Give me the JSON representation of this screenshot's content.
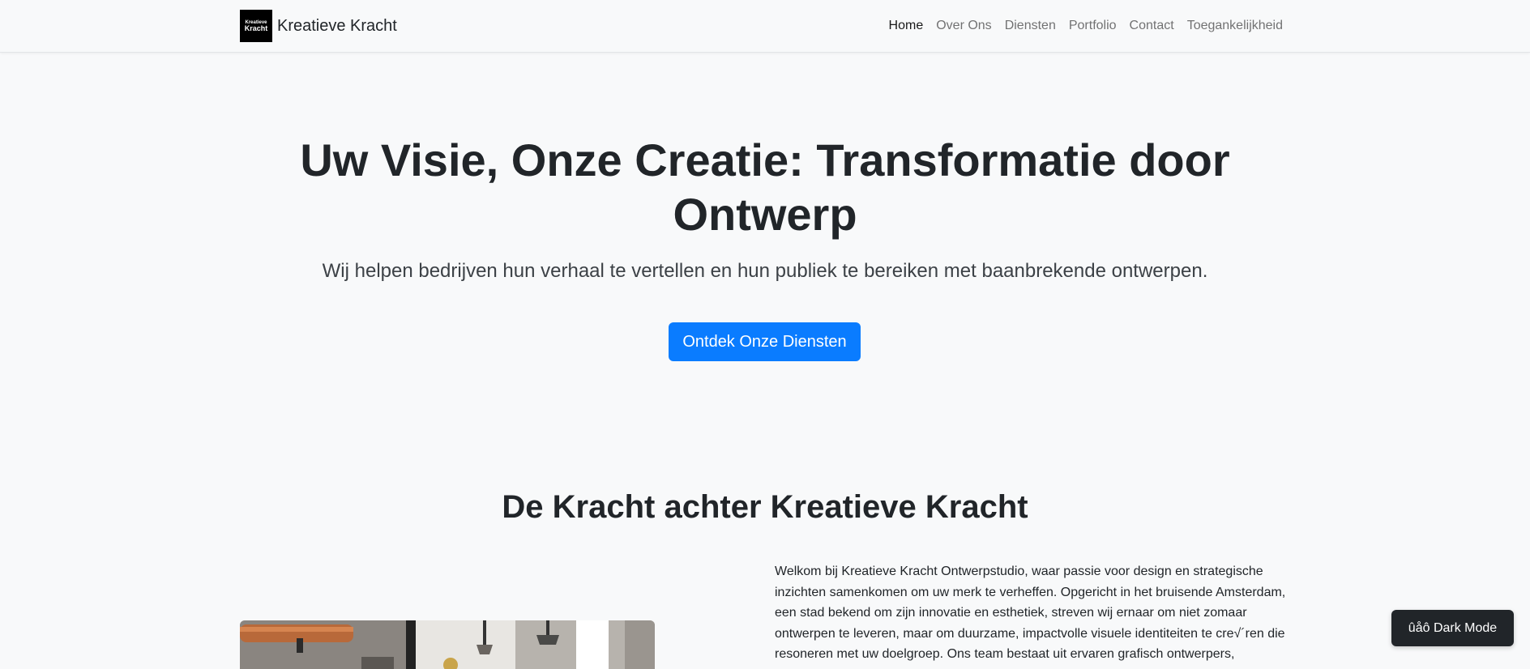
{
  "nav": {
    "logo_text_line1": "Kreatieve",
    "logo_text_line2": "Kracht",
    "brand": "Kreatieve Kracht",
    "links": [
      {
        "label": "Home",
        "active": true
      },
      {
        "label": "Over Ons",
        "active": false
      },
      {
        "label": "Diensten",
        "active": false
      },
      {
        "label": "Portfolio",
        "active": false
      },
      {
        "label": "Contact",
        "active": false
      },
      {
        "label": "Toegankelijkheid",
        "active": false
      }
    ]
  },
  "hero": {
    "title": "Uw Visie, Onze Creatie: Transformatie door Ontwerp",
    "subtitle": "Wij helpen bedrijven hun verhaal te vertellen en hun publiek te bereiken met baanbrekende ontwerpen.",
    "cta_label": "Ontdek Onze Diensten"
  },
  "about": {
    "title": "De Kracht achter Kreatieve Kracht",
    "text": "Welkom bij Kreatieve Kracht Ontwerpstudio, waar passie voor design en strategische inzichten samenkomen om uw merk te verheffen. Opgericht in het bruisende Amsterdam, een stad bekend om zijn innovatie en esthetiek, streven wij ernaar om niet zomaar ontwerpen te leveren, maar om duurzame, impactvolle visuele identiteiten te cre√´ren die resoneren met uw doelgroep. Ons team bestaat uit ervaren grafisch ontwerpers,"
  },
  "dark_mode": {
    "label": "ûåô Dark Mode"
  },
  "colors": {
    "primary": "#0a7cff",
    "dark": "#212529",
    "background": "#f8f9fa"
  }
}
